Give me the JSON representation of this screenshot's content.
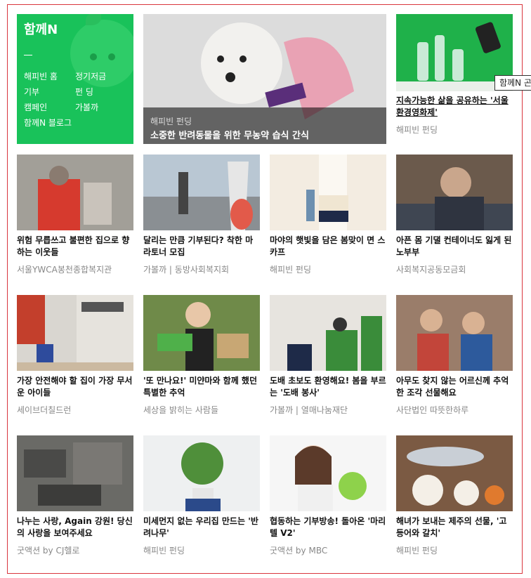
{
  "brand": {
    "title": "함께N",
    "menu": [
      "해피빈 홈",
      "정기저금",
      "기부",
      "펀 딩",
      "캠페인",
      "가볼까",
      "함께N 블로그"
    ]
  },
  "featured": {
    "category": "해피빈 펀딩",
    "title": "소중한 반려동물을 위한 무농약 습식 간식"
  },
  "tooltip": "함께N 곤",
  "cards": [
    {
      "title": "지속가능한 삶을 공유하는 '서울환경영화제'",
      "org": "해피빈 펀딩"
    },
    {
      "title": "위험 무릅쓰고 불편한 집으로 향하는 이웃들",
      "org": "서울YWCA봉천종합복지관"
    },
    {
      "title": "달리는 만큼 기부된다? 착한 마라토너 모집",
      "org": "가볼까 | 동방사회복지회"
    },
    {
      "title": "마야의 햇빛을 담은 봄맞이 면 스카프",
      "org": "해피빈 펀딩"
    },
    {
      "title": "아픈 몸 기댈 컨테이너도 잃게 된 노부부",
      "org": "사회복지공동모금회"
    },
    {
      "title": "가장 안전해야 할 집이 가장 무서운 아이들",
      "org": "세이브더칠드런"
    },
    {
      "title": "'또 만나요!' 미얀마와 함께 했던 특별한 추억",
      "org": "세상을 밝히는 사람들"
    },
    {
      "title": "도배 초보도 환영해요! 봄을 부르는 '도배 봉사'",
      "org": "가볼까 | 열매나눔재단"
    },
    {
      "title": "아무도 찾지 않는 어르신께 추억 한 조각 선물해요",
      "org": "사단법인 따뜻한하루"
    },
    {
      "title": "나누는 사랑, Again 강원! 당신의 사랑을 보여주세요",
      "org": "굿액션 by CJ헬로"
    },
    {
      "title": "미세먼지 없는 우리집 만드는 '반려나무'",
      "org": "해피빈 펀딩"
    },
    {
      "title": "협동하는 기부방송! 돌아온 '마리텔 V2'",
      "org": "굿액션 by MBC"
    },
    {
      "title": "해녀가 보내는 제주의 선물, '고등어와 갈치'",
      "org": "해피빈 펀딩"
    }
  ]
}
